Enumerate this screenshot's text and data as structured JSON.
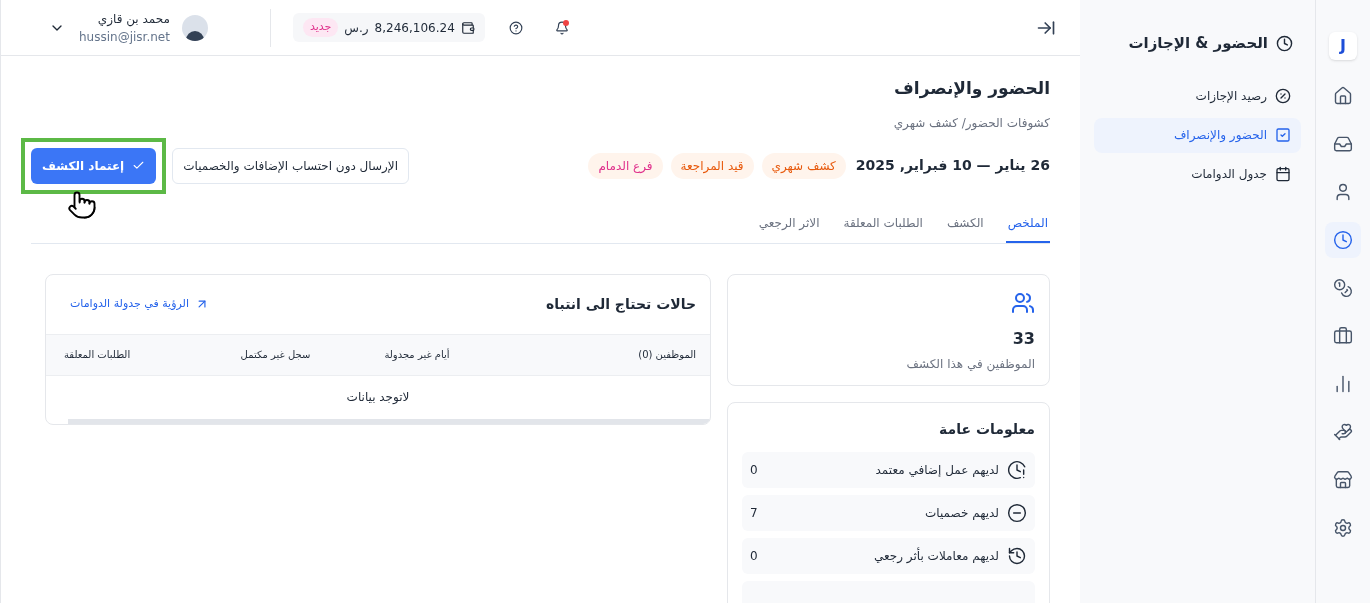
{
  "rail": [
    {
      "selected": false
    },
    {
      "selected": false
    },
    {
      "selected": false
    },
    {
      "selected": true
    },
    {
      "selected": false
    },
    {
      "selected": false
    },
    {
      "selected": false
    },
    {
      "selected": false
    },
    {
      "selected": false
    },
    {
      "selected": false
    }
  ],
  "logo": "J",
  "sidebar": {
    "title": "الحضور & الإجازات",
    "items": [
      {
        "label": "رصيد الإجازات",
        "selected": false
      },
      {
        "label": "الحضور والإنصراف",
        "selected": true
      },
      {
        "label": "جدول الدوامات",
        "selected": false
      }
    ]
  },
  "header": {
    "balance": "8,246,106.24",
    "currency": "ر.س",
    "badge": "جديد",
    "notification_dot": true,
    "user": {
      "name": "محمد بن قازي",
      "email": "hussin@jisr.net"
    }
  },
  "page": {
    "title": "الحضور والإنصراف",
    "breadcrumb": "كشوفات الحضور/ كشف شهري",
    "period": "26 يناير — 10 فبراير, 2025",
    "tags": [
      {
        "label": "كشف شهري",
        "color": "#e8590c"
      },
      {
        "label": "قيد المراجعة",
        "color": "#e8590c"
      },
      {
        "label": "فرع الدمام",
        "color": "#e0318c"
      }
    ],
    "secondary_button": "الإرسال دون احتساب الإضافات والخصميات",
    "primary_button": "إعتماد الكشف",
    "tabs": [
      {
        "label": "الملخص",
        "selected": true
      },
      {
        "label": "الكشف",
        "selected": false
      },
      {
        "label": "الطلبات المعلقة",
        "selected": false
      },
      {
        "label": "الاثر الرجعي",
        "selected": false
      }
    ]
  },
  "employees_card": {
    "count": "33",
    "label": "الموظفين في هذا الكشف"
  },
  "general_info": {
    "title": "معلومات عامة",
    "rows": [
      {
        "label": "لديهم عمل إضافي معتمد",
        "value": "0"
      },
      {
        "label": "لديهم خصميات",
        "value": "7"
      },
      {
        "label": "لديهم معاملات بأثر رجعي",
        "value": "0"
      }
    ]
  },
  "attention": {
    "title": "حالات تحتاج الى انتباه",
    "link": "الرؤية في جدولة الدوامات",
    "columns": [
      "الموظفين (0)",
      "أيام غير مجدولة",
      "سجل غير مكتمل",
      "الطلبات المعلقة"
    ],
    "empty": "لاتوجد بيانات"
  }
}
